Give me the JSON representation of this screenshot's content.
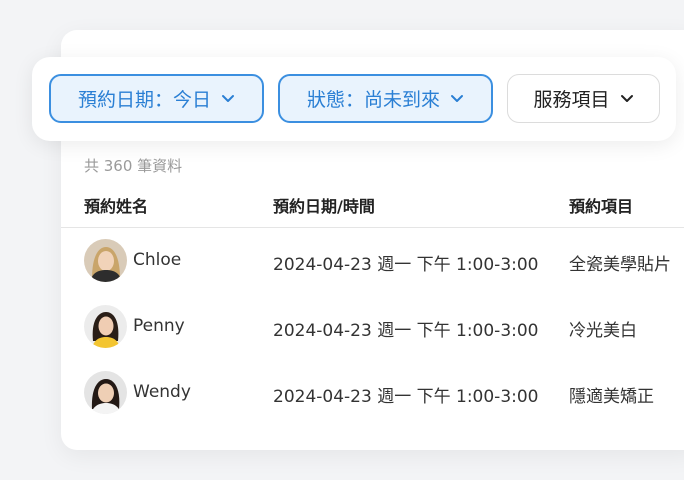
{
  "filters": [
    {
      "label": "預約日期：今日",
      "active": true
    },
    {
      "label": "狀態：尚未到來",
      "active": true
    },
    {
      "label": "服務項目",
      "active": false
    }
  ],
  "record_count": "共 360 筆資料",
  "columns": [
    "預約姓名",
    "預約日期/時間",
    "預約項目"
  ],
  "rows": [
    {
      "name": "Chloe",
      "datetime": "2024-04-23 週一 下午 1:00-3:00",
      "service": "全瓷美學貼片"
    },
    {
      "name": "Penny",
      "datetime": "2024-04-23 週一 下午 1:00-3:00",
      "service": "冷光美白"
    },
    {
      "name": "Wendy",
      "datetime": "2024-04-23 週一 下午 1:00-3:00",
      "service": "隱適美矯正"
    }
  ],
  "colors": {
    "accent": "#2a7fd4",
    "accent_bg": "#e9f3fd"
  }
}
